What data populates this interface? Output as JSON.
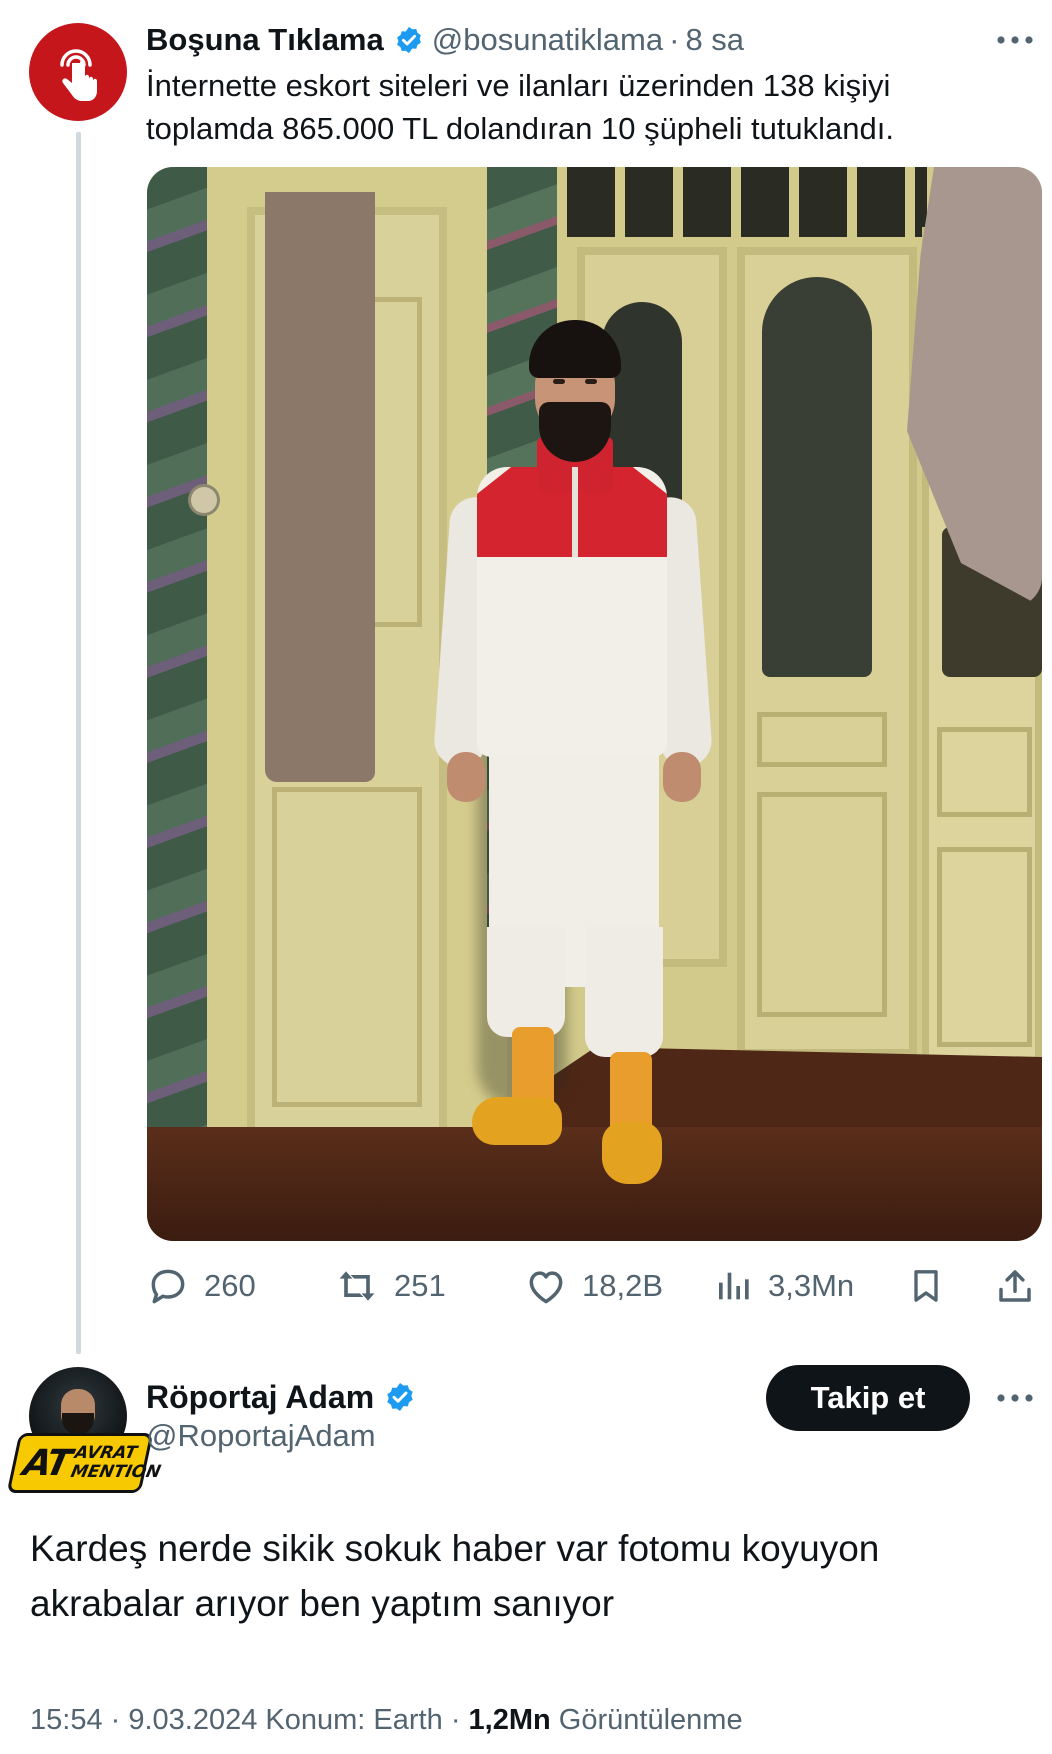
{
  "tweet1": {
    "name": "Boşuna Tıklama",
    "handle": "@bosunatiklama",
    "separator": "·",
    "time": "8 sa",
    "text": "İnternette eskort siteleri ve ilanları üzerinden 138 kişiyi\ntoplamda 865.000 TL dolandıran 10 şüpheli tutuklandı.",
    "avatar_icon": "hand-pointer-icon",
    "avatar_color": "#c5161b",
    "actions": {
      "replies": "260",
      "retweets": "251",
      "likes": "18,2B",
      "views": "3,3Mn"
    }
  },
  "tweet2": {
    "name": "Röportaj Adam",
    "handle": "@RoportajAdam",
    "follow_label": "Takip et",
    "badge_at": "AT",
    "badge_top": "AVRAT",
    "badge_bottom": "MENTION",
    "text": "Kardeş nerde sikik sokuk haber var fotomu koyuyon\nakrabalar arıyor ben yaptım sanıyor",
    "time_date": "15:54 · 9.03.2024",
    "location": "Konum: Earth",
    "separator": "·",
    "views_count": "1,2Mn",
    "views_label": "Görüntülenme"
  },
  "colors": {
    "verified_blue": "#1d9bf0",
    "text_primary": "#0f1419",
    "text_secondary": "#536471",
    "follow_button": "#0f1419"
  }
}
